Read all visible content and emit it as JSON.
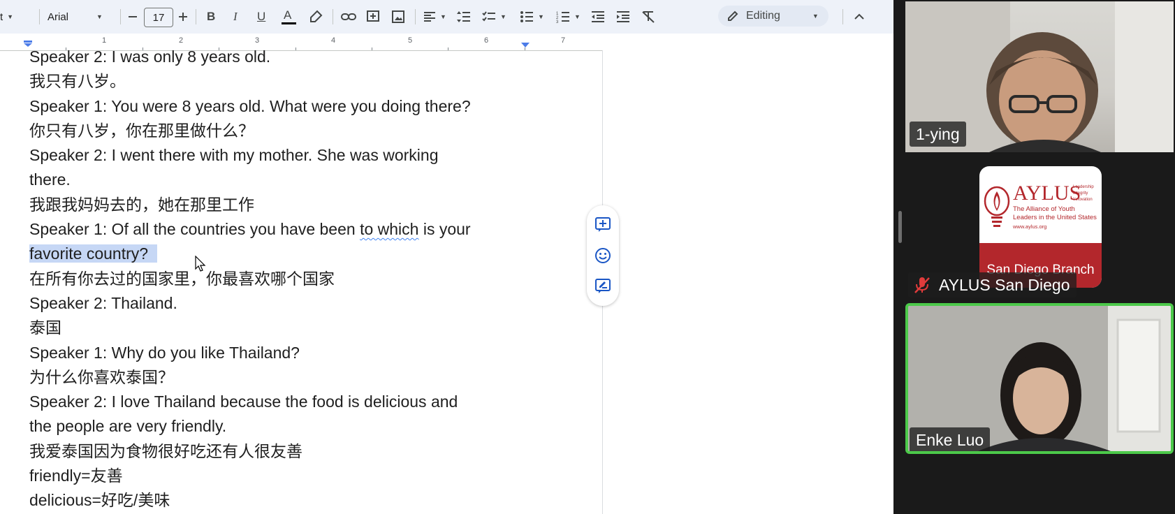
{
  "toolbar": {
    "font_partial": "t",
    "font_name": "Arial",
    "font_size": "17",
    "mode_label": "Editing"
  },
  "ruler": {
    "numbers": [
      "1",
      "2",
      "3",
      "4",
      "5",
      "6",
      "7"
    ]
  },
  "document": {
    "lines": [
      "Speaker 2: I was only 8 years old.",
      "我只有八岁。",
      "Speaker 1: You were 8 years old. What were you doing there?",
      "你只有八岁，你在那里做什么？",
      "Speaker 2: I went there with my mother. She was working",
      "there.",
      "我跟我妈妈去的，她在那里工作",
      "Speaker 1: Of all the countries you have been ",
      "to which",
      " is your",
      "favorite country?",
      "在所有你去过的国家里，你最喜欢哪个国家",
      "Speaker 2: Thailand.",
      "泰国",
      "Speaker 1: Why do you like Thailand?",
      "为什么你喜欢泰国？",
      "Speaker 2: I love Thailand because the food is delicious and",
      "the people are very friendly.",
      "我爱泰国因为食物很好吃还有人很友善",
      "friendly=友善",
      "delicious=好吃/美味"
    ]
  },
  "participants": {
    "p1": {
      "name": "1-ying"
    },
    "p2": {
      "name": "AYLUS San Diego",
      "logo_title": "AYLUS",
      "logo_tagline": "The Alliance of Youth Leaders in the United States",
      "logo_url": "www.aylus.org",
      "logo_words": [
        "Leadership",
        "Integrity",
        "Innovation"
      ],
      "branch": "San Diego Branch"
    },
    "p3": {
      "name": "Enke Luo"
    }
  },
  "colors": {
    "toolbar_bg": "#eef2f9",
    "selection": "#c6d7f5",
    "active_speaker_border": "#4cc94a",
    "aylus_red": "#b3272c"
  }
}
